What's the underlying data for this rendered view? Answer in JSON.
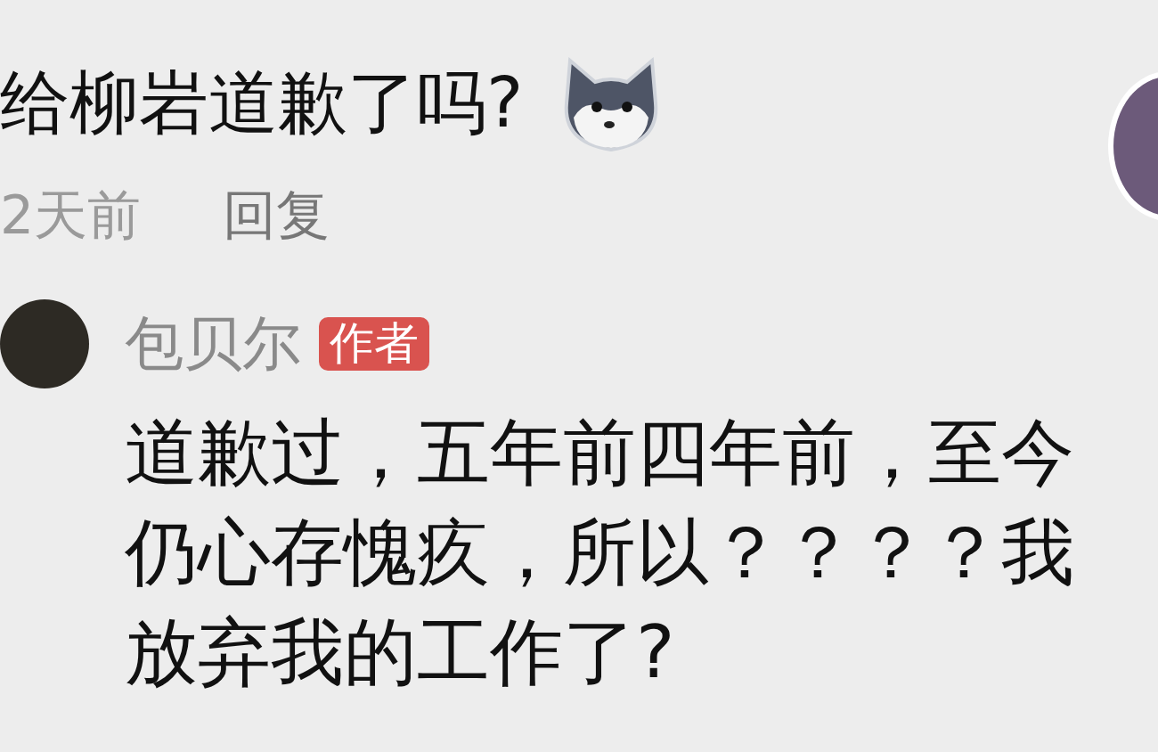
{
  "comment": {
    "text": "给柳岩道歉了吗?",
    "time": "2天前",
    "reply_action": "回复"
  },
  "reply": {
    "author": "包贝尔",
    "badge": "作者",
    "lines": [
      "道歉过，五年前四年前，至今",
      "仍心存愧疚，所以？？？？我",
      "放弃我的工作了?"
    ]
  }
}
